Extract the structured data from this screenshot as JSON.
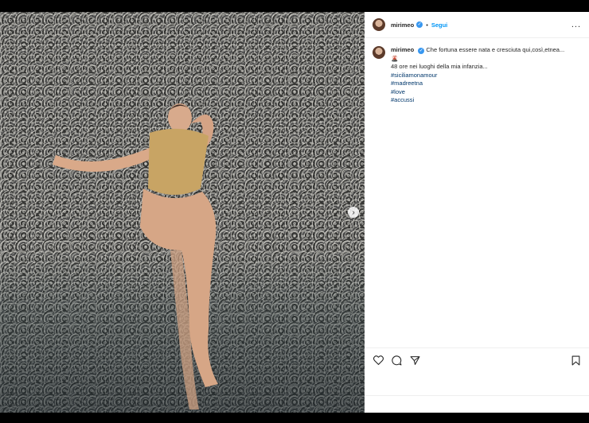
{
  "post": {
    "username": "mirimeo",
    "follow_label": "Segui",
    "separator": "•",
    "more_label": "...",
    "caption": {
      "username": "mirimeo",
      "text_line1": "Che fortuna essere nata e cresciuta qui,così,etnea...",
      "emoji": "🌋",
      "text_line2": "48 ore nei luoghi della mia infanzia...",
      "hashtags": [
        "#siciliamonamour",
        "#madreetna",
        "#love",
        "#accussi"
      ]
    },
    "carousel_next": "›"
  },
  "colors": {
    "link": "#0095f6",
    "hashtag": "#00376b",
    "verified": "#3897f0"
  }
}
